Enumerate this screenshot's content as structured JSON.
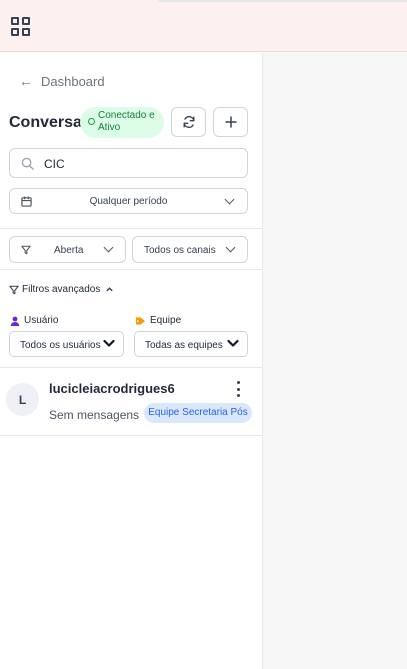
{
  "colors": {
    "topbar_bg": "#fdf1ef",
    "status_bg": "#dcfce7",
    "status_text": "#15803d",
    "tag_bg": "#dbe8fb",
    "tag_text": "#2563eb"
  },
  "topbar": {
    "menu_icon": "grid-apps-icon"
  },
  "sidebar": {
    "back_label": "Dashboard",
    "title": "Conversas",
    "status": "Conectado e Ativo",
    "refresh_icon": "refresh-icon",
    "add_icon": "plus-icon",
    "search": {
      "value": "CIC",
      "icon": "search-icon"
    },
    "period": {
      "value": "Qualquer período",
      "icon": "calendar-icon"
    },
    "filters": {
      "status_value": "Aberta",
      "channel_value": "Todos os canais"
    },
    "advanced": {
      "label": "Filtros avançados",
      "user_label": "Usuário",
      "user_value": "Todos os usuários",
      "team_label": "Equipe",
      "team_value": "Todas as equipes"
    },
    "conversations": [
      {
        "avatar": "L",
        "name": "lucicleiacrodrigues6",
        "last_message": "Sem mensagens",
        "tag": "Equipe Secretaria Pós"
      }
    ]
  }
}
